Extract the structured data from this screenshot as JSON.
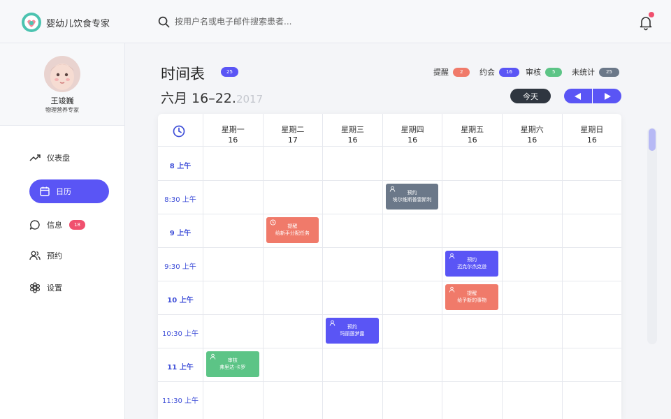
{
  "header": {
    "brand": "婴幼儿饮食专家",
    "search_placeholder": "按用户名或电子邮件搜索患者..."
  },
  "profile": {
    "name": "王竣巍",
    "role": "物理营养专家"
  },
  "sidebar": {
    "items": [
      {
        "label": "仪表盘",
        "icon": "trending-up-icon",
        "active": false
      },
      {
        "label": "日历",
        "icon": "calendar-icon",
        "active": true
      },
      {
        "label": "信息",
        "icon": "message-icon",
        "active": false,
        "badge": "18"
      },
      {
        "label": "预约",
        "icon": "users-icon",
        "active": false
      },
      {
        "label": "设置",
        "icon": "gear-icon",
        "active": false
      }
    ]
  },
  "page": {
    "title": "时间表",
    "title_badge": "25",
    "date_main": "六月 16–22.",
    "date_year": "2017",
    "today_label": "今天"
  },
  "legend": [
    {
      "label": "提醒",
      "count": "2",
      "color": "#f07a6a"
    },
    {
      "label": "约会",
      "count": "16",
      "color": "#5a55f5"
    },
    {
      "label": "审核",
      "count": "5",
      "color": "#5cc486"
    },
    {
      "label": "未统计",
      "count": "25",
      "color": "#6b7889"
    }
  ],
  "calendar": {
    "days": [
      {
        "name": "星期一",
        "date": "16"
      },
      {
        "name": "星期二",
        "date": "17"
      },
      {
        "name": "星期三",
        "date": "16"
      },
      {
        "name": "星期四",
        "date": "16"
      },
      {
        "name": "星期五",
        "date": "16"
      },
      {
        "name": "星期六",
        "date": "16"
      },
      {
        "name": "星期日",
        "date": "16"
      }
    ],
    "times": [
      {
        "label": "8 上午",
        "bold": true
      },
      {
        "label": "8:30 上午",
        "bold": false
      },
      {
        "label": "9 上午",
        "bold": true
      },
      {
        "label": "9:30 上午",
        "bold": false
      },
      {
        "label": "10 上午",
        "bold": true
      },
      {
        "label": "10:30 上午",
        "bold": false
      },
      {
        "label": "11 上午",
        "bold": true
      },
      {
        "label": "11:30 上午",
        "bold": false
      }
    ],
    "events": [
      {
        "day": 3,
        "slot": 1,
        "type": "预约",
        "title": "埃尔维斯普雷斯利",
        "color": "#6b7889",
        "icon": "person-icon"
      },
      {
        "day": 1,
        "slot": 2,
        "type": "提醒",
        "title": "给新手分配任务",
        "color": "#f07a6a",
        "icon": "clock-icon"
      },
      {
        "day": 4,
        "slot": 3,
        "type": "预约",
        "title": "迈克尔杰克逊",
        "color": "#5a55f5",
        "icon": "person-icon"
      },
      {
        "day": 4,
        "slot": 4,
        "type": "提醒",
        "title": "给予新的事物",
        "color": "#f07a6a",
        "icon": "person-icon"
      },
      {
        "day": 2,
        "slot": 5,
        "type": "预约",
        "title": "玛丽莲梦露",
        "color": "#5a55f5",
        "icon": "person-icon"
      },
      {
        "day": 0,
        "slot": 6,
        "type": "审核",
        "title": "弗里达·卡罗",
        "color": "#5cc486",
        "icon": "person-icon"
      }
    ]
  }
}
